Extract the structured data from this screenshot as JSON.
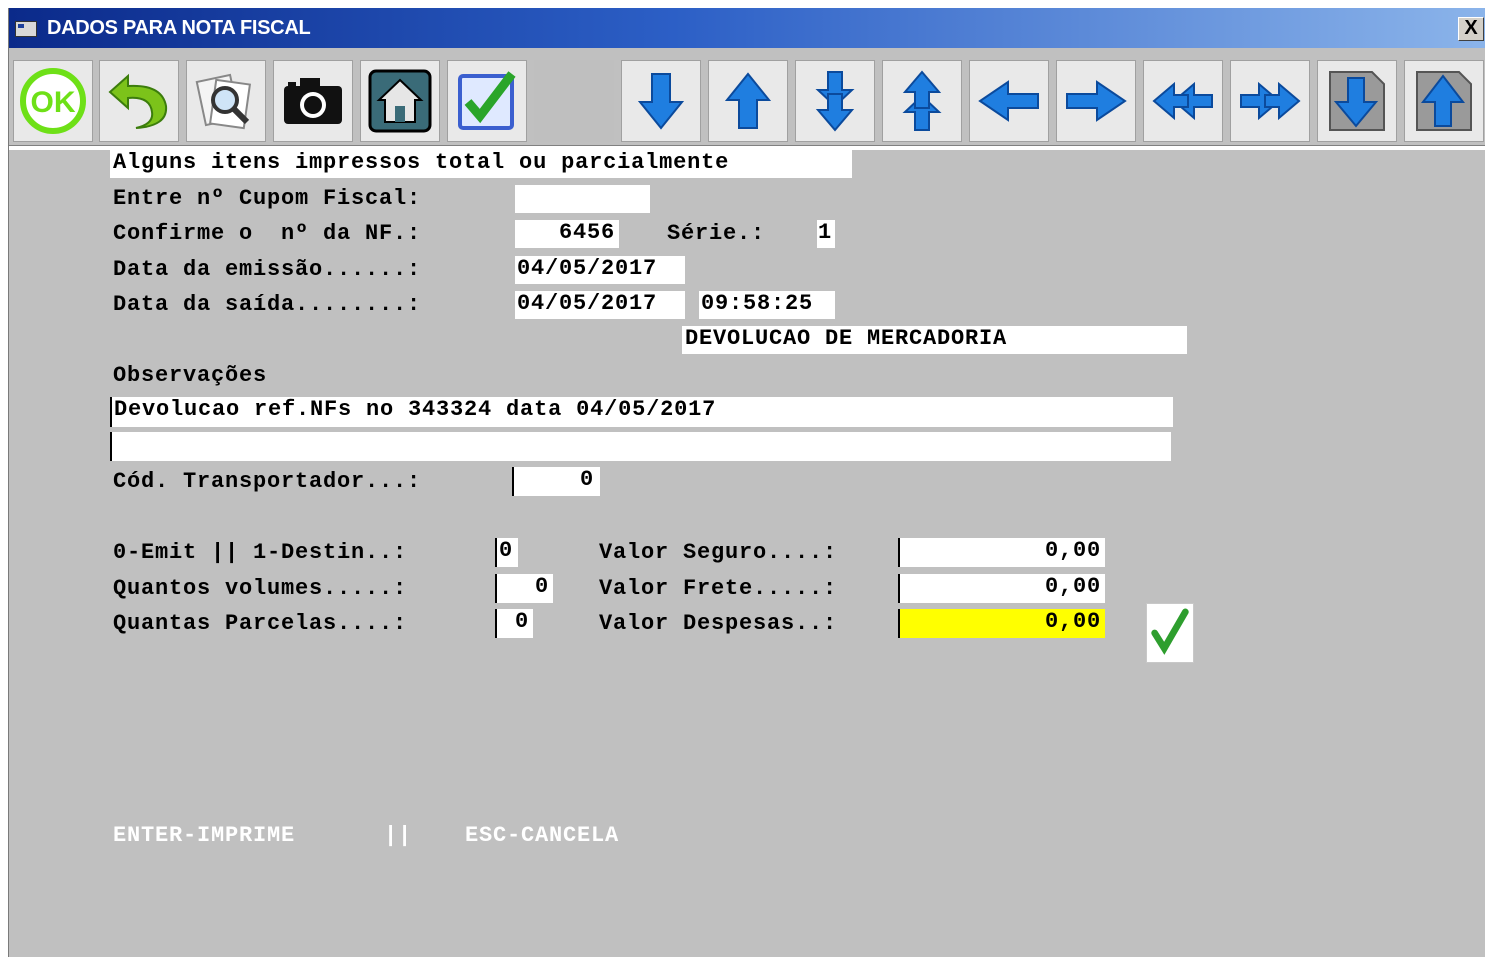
{
  "window": {
    "title": "DADOS PARA NOTA FISCAL",
    "close_label": "X"
  },
  "toolbar": {
    "buttons": [
      {
        "name": "ok-button",
        "icon": "ok-icon"
      },
      {
        "name": "back-button",
        "icon": "undo-arrow-icon"
      },
      {
        "name": "search-button",
        "icon": "magnifier-icon"
      },
      {
        "name": "camera-button",
        "icon": "camera-icon"
      },
      {
        "name": "home-button",
        "icon": "home-icon"
      },
      {
        "name": "check-button",
        "icon": "checkbox-icon"
      },
      {
        "name": "blank-button",
        "icon": ""
      },
      {
        "name": "down-button",
        "icon": "arrow-down-icon"
      },
      {
        "name": "up-button",
        "icon": "arrow-up-icon"
      },
      {
        "name": "page-down-button",
        "icon": "double-arrow-down-icon"
      },
      {
        "name": "page-up-button",
        "icon": "double-arrow-up-icon"
      },
      {
        "name": "left-button",
        "icon": "arrow-left-icon"
      },
      {
        "name": "right-button",
        "icon": "arrow-right-icon"
      },
      {
        "name": "first-button",
        "icon": "double-arrow-left-icon"
      },
      {
        "name": "last-button",
        "icon": "double-arrow-right-icon"
      },
      {
        "name": "end-button",
        "icon": "doc-arrow-down-icon"
      },
      {
        "name": "top-button",
        "icon": "doc-arrow-up-icon"
      }
    ]
  },
  "form": {
    "notice": "Alguns itens impressos total ou parcialmente",
    "cupom_label": "Entre nº Cupom Fiscal:",
    "cupom_value": "",
    "nf_label": "Confirme o  nº da NF.:",
    "nf_value": "6456",
    "serie_label": "Série.:",
    "serie_value": "1",
    "emissao_label": "Data da emissão......:",
    "emissao_value": "04/05/2017",
    "saida_label": "Data da saída........:",
    "saida_date": "04/05/2017",
    "saida_time": "09:58:25",
    "natureza": "DEVOLUCAO DE MERCADORIA",
    "obs_label": "Observações",
    "obs_line1": "Devolucao ref.NFs no 343324 data 04/05/2017",
    "obs_line2": "",
    "transportador_label": "Cód. Transportador...:",
    "transportador_value": "0",
    "emit_label": "0-Emit || 1-Destin..:",
    "emit_value": "0",
    "volumes_label": "Quantos volumes.....:",
    "volumes_value": "0",
    "parcelas_label": "Quantas Parcelas....:",
    "parcelas_value": "0",
    "seguro_label": "Valor Seguro....:",
    "seguro_value": "0,00",
    "frete_label": "Valor Frete.....:",
    "frete_value": "0,00",
    "despesas_label": "Valor Despesas..:",
    "despesas_value": "0,00",
    "highlight_color": "#ffff00"
  },
  "footer": {
    "enter_hint": "ENTER-IMPRIME",
    "separator": "||",
    "esc_hint": "ESC-CANCELA"
  }
}
